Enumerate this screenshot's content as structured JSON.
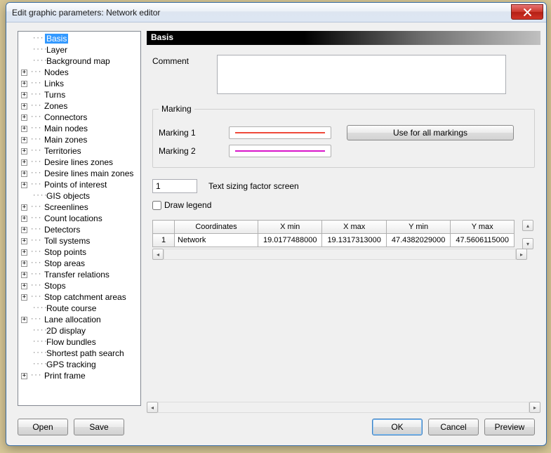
{
  "window": {
    "title": "Edit graphic parameters: Network editor"
  },
  "tree": [
    {
      "label": "Basis",
      "exp": false,
      "child": true,
      "selected": true
    },
    {
      "label": "Layer",
      "exp": false,
      "child": true
    },
    {
      "label": "Background map",
      "exp": false,
      "child": true
    },
    {
      "label": "Nodes",
      "exp": true
    },
    {
      "label": "Links",
      "exp": true
    },
    {
      "label": "Turns",
      "exp": true
    },
    {
      "label": "Zones",
      "exp": true
    },
    {
      "label": "Connectors",
      "exp": true
    },
    {
      "label": "Main nodes",
      "exp": true
    },
    {
      "label": "Main zones",
      "exp": true
    },
    {
      "label": "Territories",
      "exp": true
    },
    {
      "label": "Desire lines zones",
      "exp": true
    },
    {
      "label": "Desire lines main zones",
      "exp": true
    },
    {
      "label": "Points of interest",
      "exp": true
    },
    {
      "label": "GIS objects",
      "exp": false,
      "child": true
    },
    {
      "label": "Screenlines",
      "exp": true
    },
    {
      "label": "Count locations",
      "exp": true
    },
    {
      "label": "Detectors",
      "exp": true
    },
    {
      "label": "Toll systems",
      "exp": true
    },
    {
      "label": "Stop points",
      "exp": true
    },
    {
      "label": "Stop areas",
      "exp": true
    },
    {
      "label": "Transfer relations",
      "exp": true
    },
    {
      "label": "Stops",
      "exp": true
    },
    {
      "label": "Stop catchment areas",
      "exp": true
    },
    {
      "label": "Route course",
      "exp": false,
      "child": true
    },
    {
      "label": "Lane allocation",
      "exp": true
    },
    {
      "label": "2D display",
      "exp": false,
      "child": true
    },
    {
      "label": "Flow bundles",
      "exp": false,
      "child": true
    },
    {
      "label": "Shortest path search",
      "exp": false,
      "child": true
    },
    {
      "label": "GPS tracking",
      "exp": false,
      "child": true
    },
    {
      "label": "Print frame",
      "exp": true
    }
  ],
  "panel": {
    "header": "Basis",
    "comment_label": "Comment",
    "comment_value": "",
    "marking_legend": "Marking",
    "marking1_label": "Marking 1",
    "marking2_label": "Marking 2",
    "marking1_color": "#ef4a3a",
    "marking2_color": "#d815c9",
    "use_all_label": "Use for all markings",
    "text_sizing_value": "1",
    "text_sizing_label": "Text sizing factor screen",
    "draw_legend_label": "Draw legend",
    "draw_legend_checked": false,
    "grid": {
      "headers": [
        "",
        "Coordinates",
        "X min",
        "X max",
        "Y min",
        "Y max"
      ],
      "rows": [
        {
          "n": "1",
          "coord": "Network",
          "xmin": "19.0177488000",
          "xmax": "19.1317313000",
          "ymin": "47.4382029000",
          "ymax": "47.5606115000"
        }
      ]
    }
  },
  "buttons": {
    "open": "Open",
    "save": "Save",
    "ok": "OK",
    "cancel": "Cancel",
    "preview": "Preview"
  }
}
